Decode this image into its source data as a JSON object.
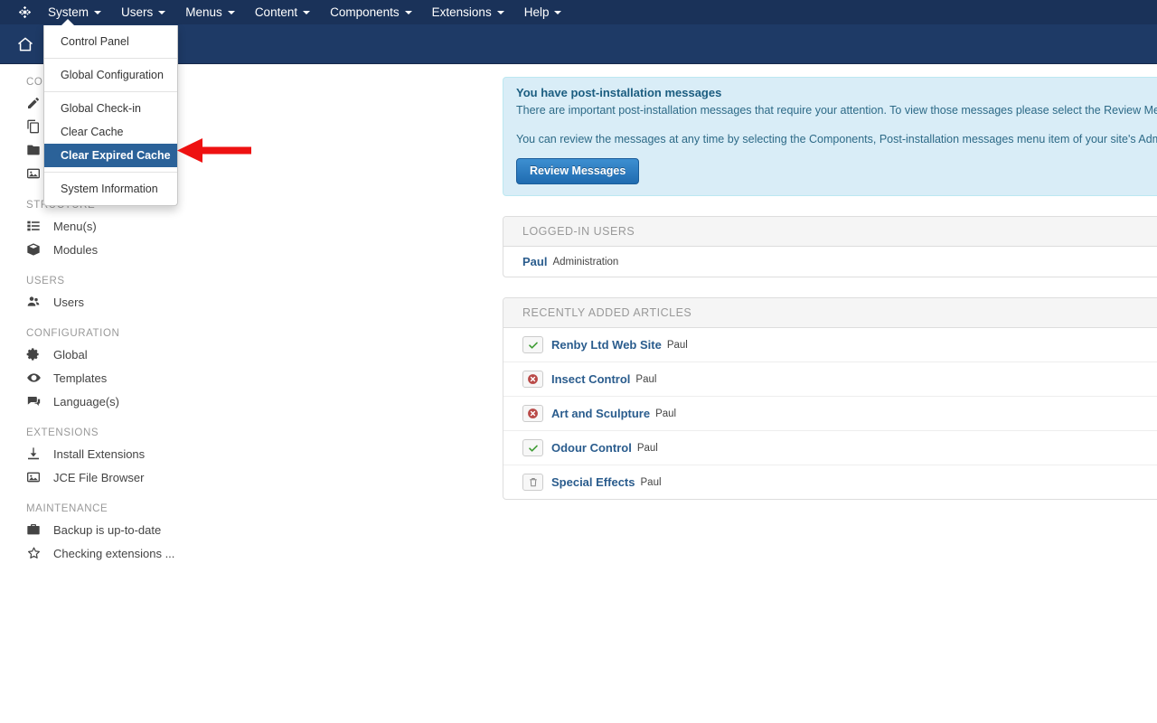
{
  "topnav": {
    "logo_icon": "joomla-logo-icon",
    "items": [
      {
        "label": "System",
        "caret": true
      },
      {
        "label": "Users",
        "caret": true
      },
      {
        "label": "Menus",
        "caret": true
      },
      {
        "label": "Content",
        "caret": true
      },
      {
        "label": "Components",
        "caret": true
      },
      {
        "label": "Extensions",
        "caret": true
      },
      {
        "label": "Help",
        "caret": true
      }
    ]
  },
  "subbar": {
    "home_icon": "home-icon"
  },
  "system_menu": {
    "groups": [
      {
        "items": [
          {
            "label": "Control Panel",
            "active": false
          }
        ]
      },
      {
        "items": [
          {
            "label": "Global Configuration",
            "active": false
          }
        ]
      },
      {
        "items": [
          {
            "label": "Global Check-in",
            "active": false
          },
          {
            "label": "Clear Cache",
            "active": false
          },
          {
            "label": "Clear Expired Cache",
            "active": true
          }
        ]
      },
      {
        "items": [
          {
            "label": "System Information",
            "active": false
          }
        ]
      }
    ]
  },
  "annotation": {
    "arrow_color": "#ee1111",
    "arrow_direction": "left"
  },
  "sidebar": {
    "sections": [
      {
        "heading": "CONTENT",
        "items": [
          {
            "label": "",
            "icon": "pencil-icon"
          },
          {
            "label": "",
            "icon": "copy-icon"
          },
          {
            "label": "",
            "icon": "folder-icon"
          },
          {
            "label": "",
            "icon": "image-icon"
          }
        ]
      },
      {
        "heading": "STRUCTURE",
        "items": [
          {
            "label": "Menu(s)",
            "icon": "list-icon"
          },
          {
            "label": "Modules",
            "icon": "cube-icon"
          }
        ]
      },
      {
        "heading": "USERS",
        "items": [
          {
            "label": "Users",
            "icon": "users-icon"
          }
        ]
      },
      {
        "heading": "CONFIGURATION",
        "items": [
          {
            "label": "Global",
            "icon": "gear-icon"
          },
          {
            "label": "Templates",
            "icon": "eye-icon"
          },
          {
            "label": "Language(s)",
            "icon": "comment-icon"
          }
        ]
      },
      {
        "heading": "EXTENSIONS",
        "items": [
          {
            "label": "Install Extensions",
            "icon": "download-icon"
          },
          {
            "label": "JCE File Browser",
            "icon": "image-icon"
          }
        ]
      },
      {
        "heading": "MAINTENANCE",
        "items": [
          {
            "label": "Backup is up-to-date",
            "icon": "briefcase-icon"
          },
          {
            "label": "Checking extensions ...",
            "icon": "star-icon"
          }
        ]
      }
    ]
  },
  "alert": {
    "title": "You have post-installation messages",
    "paragraph1": "There are important post-installation messages that require your attention. To view those messages please select the Review Messag",
    "paragraph2": "You can review the messages at any time by selecting the Components, Post-installation messages menu item of your site's Adminis",
    "button_label": "Review Messages"
  },
  "logged_in_users": {
    "heading": "LOGGED-IN USERS",
    "rows": [
      {
        "name": "Paul",
        "group": "Administration"
      }
    ]
  },
  "recent_articles": {
    "heading": "RECENTLY ADDED ARTICLES",
    "rows": [
      {
        "title": "Renby Ltd Web Site",
        "author": "Paul",
        "status": "published"
      },
      {
        "title": "Insect Control",
        "author": "Paul",
        "status": "unpublished"
      },
      {
        "title": "Art and Sculpture",
        "author": "Paul",
        "status": "unpublished"
      },
      {
        "title": "Odour Control",
        "author": "Paul",
        "status": "published"
      },
      {
        "title": "Special Effects",
        "author": "Paul",
        "status": "trashed"
      }
    ]
  }
}
